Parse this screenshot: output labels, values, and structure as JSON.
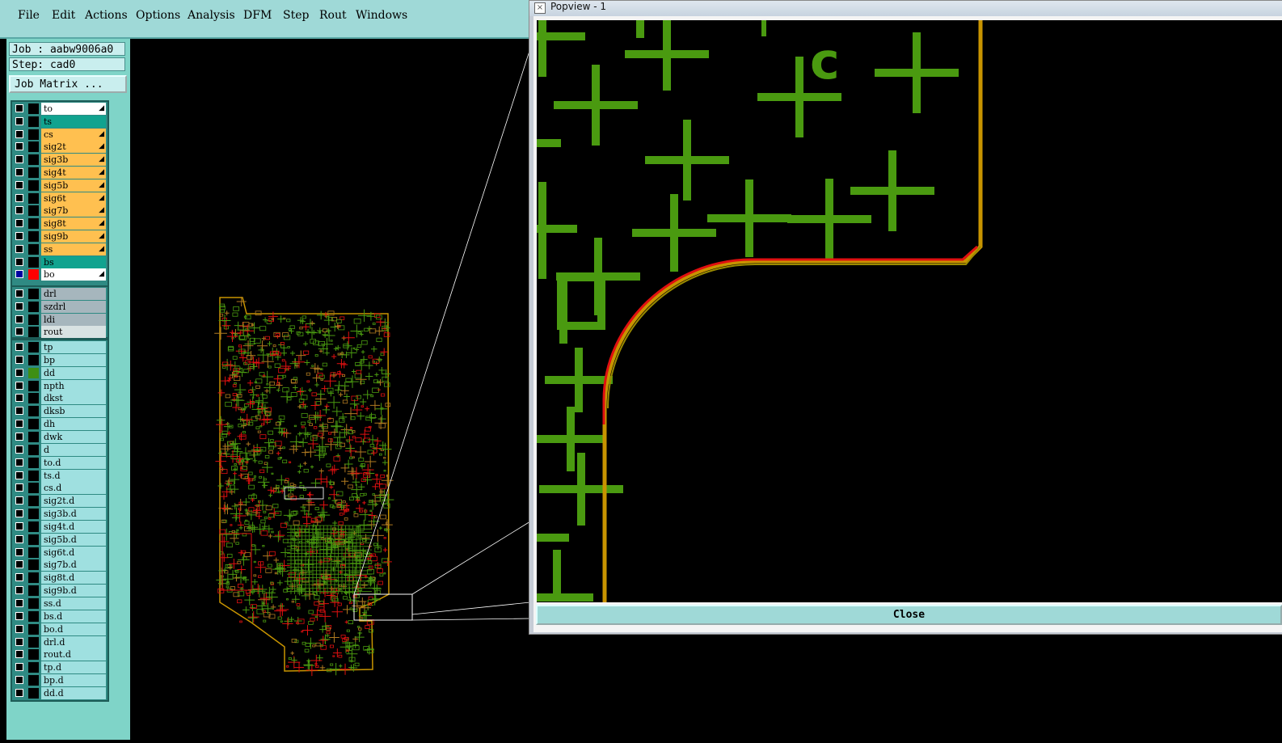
{
  "menu": [
    {
      "label": "File"
    },
    {
      "label": "Edit"
    },
    {
      "label": "Actions"
    },
    {
      "label": "Options"
    },
    {
      "label": "Analysis"
    },
    {
      "label": "DFM"
    },
    {
      "label": "Step"
    },
    {
      "label": "Rout"
    },
    {
      "label": "Windows"
    }
  ],
  "left": {
    "job_label": "Job : aabw9006a0",
    "step_label": "Step: cad0",
    "job_matrix_button": "Job Matrix ..."
  },
  "layers_board": [
    {
      "name": "to",
      "color": "#ffffff",
      "arrow": true
    },
    {
      "name": "ts",
      "color": "#11a38f",
      "arrow": false
    },
    {
      "name": "cs",
      "color": "#ffc050",
      "arrow": true
    },
    {
      "name": "sig2t",
      "color": "#ffc050",
      "arrow": true
    },
    {
      "name": "sig3b",
      "color": "#ffc050",
      "arrow": true
    },
    {
      "name": "sig4t",
      "color": "#ffc050",
      "arrow": true
    },
    {
      "name": "sig5b",
      "color": "#ffc050",
      "arrow": true
    },
    {
      "name": "sig6t",
      "color": "#ffc050",
      "arrow": true
    },
    {
      "name": "sig7b",
      "color": "#ffc050",
      "arrow": true
    },
    {
      "name": "sig8t",
      "color": "#ffc050",
      "arrow": true
    },
    {
      "name": "sig9b",
      "color": "#ffc050",
      "arrow": true
    },
    {
      "name": "ss",
      "color": "#ffc050",
      "arrow": true
    },
    {
      "name": "bs",
      "color": "#11a38f",
      "arrow": false
    },
    {
      "name": "bo",
      "color": "#ffffff",
      "arrow": true,
      "active": true
    }
  ],
  "layers_drill": [
    {
      "name": "drl",
      "color": "#a6b6bd"
    },
    {
      "name": "szdrl",
      "color": "#a6b6bd"
    },
    {
      "name": "ldi",
      "color": "#a6b6bd"
    },
    {
      "name": "rout",
      "color": "#d8e2e2"
    }
  ],
  "layers_misc": [
    {
      "name": "tp"
    },
    {
      "name": "bp"
    },
    {
      "name": "dd",
      "affected": true
    },
    {
      "name": "npth"
    },
    {
      "name": "dkst"
    },
    {
      "name": "dksb"
    },
    {
      "name": "dh"
    },
    {
      "name": "dwk"
    },
    {
      "name": "d"
    },
    {
      "name": "to.d"
    },
    {
      "name": "ts.d"
    },
    {
      "name": "cs.d"
    },
    {
      "name": "sig2t.d"
    },
    {
      "name": "sig3b.d"
    },
    {
      "name": "sig4t.d"
    },
    {
      "name": "sig5b.d"
    },
    {
      "name": "sig6t.d"
    },
    {
      "name": "sig7b.d"
    },
    {
      "name": "sig8t.d"
    },
    {
      "name": "sig9b.d"
    },
    {
      "name": "ss.d"
    },
    {
      "name": "bs.d"
    },
    {
      "name": "bo.d"
    },
    {
      "name": "drl.d"
    },
    {
      "name": "rout.d"
    },
    {
      "name": "tp.d"
    },
    {
      "name": "bp.d"
    },
    {
      "name": "dd.d"
    }
  ],
  "popview": {
    "title": "Popview - 1",
    "close_label": "Close",
    "text_c": "c"
  },
  "colors": {
    "menu_bg": "#9fd9d7",
    "pad_green": "#4a9a10",
    "outline_red": "#e01010",
    "outline_orange": "#c89400"
  }
}
